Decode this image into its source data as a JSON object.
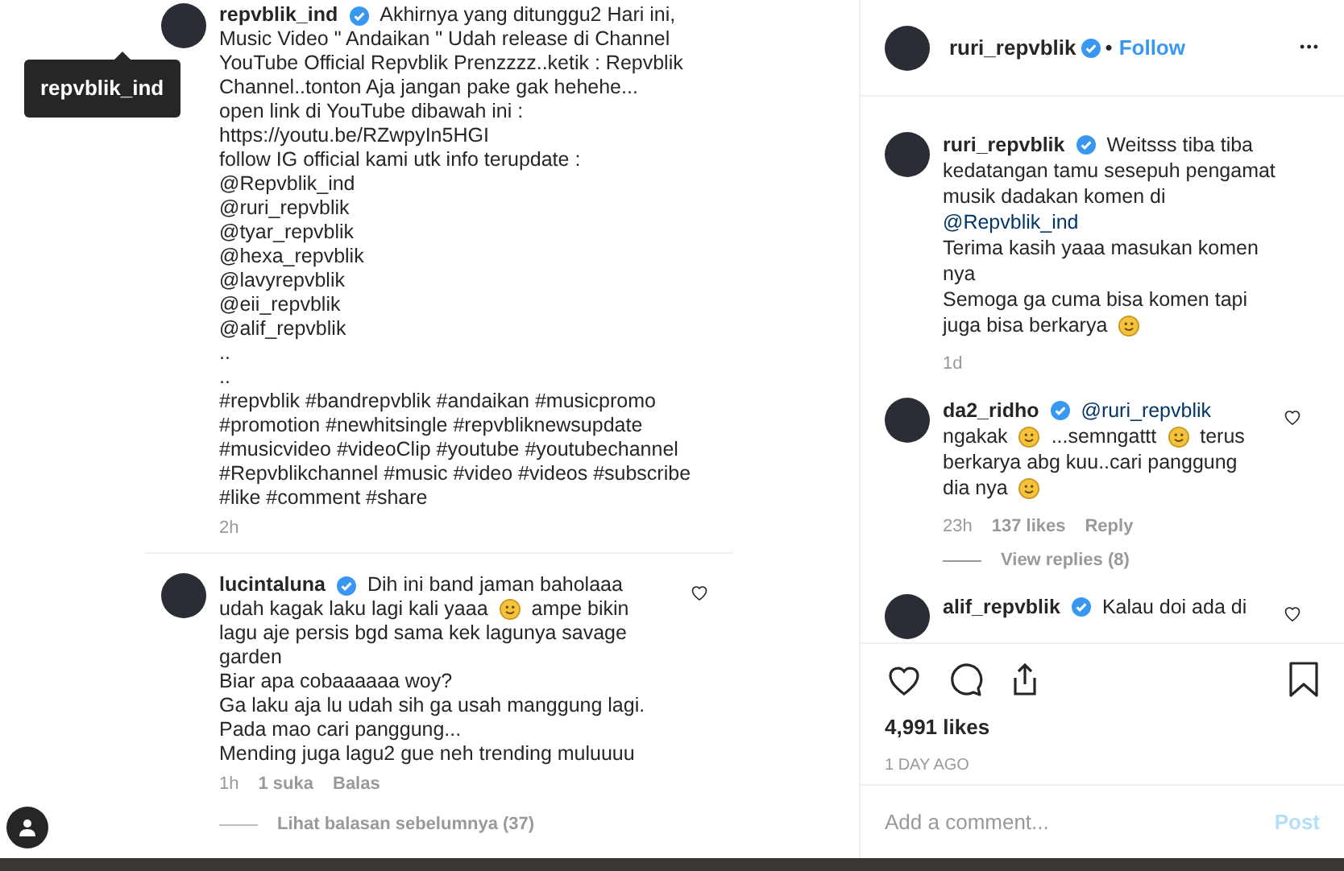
{
  "tooltip": {
    "text": "repvblik_ind"
  },
  "left_comments": [
    {
      "username": "repvblik_ind",
      "verified": true,
      "heart": false,
      "lines": [
        [
          {
            "kind": "text",
            "text": "Akhirnya yang ditunggu2 Hari ini,"
          }
        ],
        [
          {
            "kind": "text",
            "text": "Music Video \" Andaikan \" Udah release di Channel"
          }
        ],
        [
          {
            "kind": "text",
            "text": "YouTube Official Repvblik Prenzzzz..ketik : Repvblik"
          }
        ],
        [
          {
            "kind": "text",
            "text": "Channel..tonton Aja jangan pake gak hehehe..."
          }
        ],
        [
          {
            "kind": "text",
            "text": "open link di YouTube dibawah ini :"
          }
        ],
        [
          {
            "kind": "text",
            "text": "https://youtu.be/RZwpyIn5HGI"
          }
        ],
        [
          {
            "kind": "text",
            "text": "follow IG official kami utk info terupdate :"
          }
        ],
        [
          {
            "kind": "text",
            "text": "@Repvblik_ind"
          }
        ],
        [
          {
            "kind": "text",
            "text": "@ruri_repvblik"
          }
        ],
        [
          {
            "kind": "text",
            "text": "@tyar_repvblik"
          }
        ],
        [
          {
            "kind": "text",
            "text": "@hexa_repvblik"
          }
        ],
        [
          {
            "kind": "text",
            "text": "@lavyrepvblik"
          }
        ],
        [
          {
            "kind": "text",
            "text": "@eii_repvblik"
          }
        ],
        [
          {
            "kind": "text",
            "text": "@alif_repvblik"
          }
        ],
        [
          {
            "kind": "text",
            "text": ".."
          }
        ],
        [
          {
            "kind": "text",
            "text": ".."
          }
        ],
        [
          {
            "kind": "text",
            "text": "#repvblik #bandrepvblik #andaikan #musicpromo"
          }
        ],
        [
          {
            "kind": "text",
            "text": "#promotion #newhitsingle #repvbliknewsupdate"
          }
        ],
        [
          {
            "kind": "text",
            "text": "#musicvideo #videoClip #youtube #youtubechannel"
          }
        ],
        [
          {
            "kind": "text",
            "text": "#Repvblikchannel #music #video #videos #subscribe"
          }
        ],
        [
          {
            "kind": "text",
            "text": "#like #comment #share"
          }
        ]
      ],
      "meta": [
        "2h"
      ]
    },
    {
      "username": "lucintaluna",
      "verified": true,
      "heart": true,
      "lines": [
        [
          {
            "kind": "text",
            "text": "Dih ini band jaman baholaaa"
          }
        ],
        [
          {
            "kind": "text",
            "text": "udah kagak laku lagi kali yaaa"
          },
          {
            "kind": "emoji"
          },
          {
            "kind": "text",
            "text": "ampe bikin"
          }
        ],
        [
          {
            "kind": "text",
            "text": "lagu aje persis bgd sama kek lagunya savage"
          }
        ],
        [
          {
            "kind": "text",
            "text": "garden"
          }
        ],
        [
          {
            "kind": "text",
            "text": "Biar apa cobaaaaaa woy?"
          }
        ],
        [
          {
            "kind": "text",
            "text": "Ga laku aja lu udah sih ga usah manggung lagi."
          }
        ],
        [
          {
            "kind": "text",
            "text": "Pada mao cari panggung..."
          }
        ],
        [
          {
            "kind": "text",
            "text": "Mending juga lagu2 gue neh trending muluuuu"
          }
        ]
      ],
      "meta": [
        "1h",
        "1 suka",
        "Balas"
      ]
    }
  ],
  "left_view_replies": "Lihat balasan sebelumnya (37)",
  "post_header": {
    "username": "ruri_repvblik",
    "verified": true,
    "separator": "•",
    "follow": "Follow",
    "more": "•••"
  },
  "right_comments": [
    {
      "username": "ruri_repvblik",
      "verified": true,
      "heart": false,
      "lines": [
        [
          {
            "kind": "text",
            "text": "Weitsss tiba tiba"
          }
        ],
        [
          {
            "kind": "text",
            "text": "kedatangan tamu sesepuh pengamat"
          }
        ],
        [
          {
            "kind": "text",
            "text": "musik dadakan komen di"
          }
        ],
        [
          {
            "kind": "mention",
            "text": "@Repvblik_ind"
          }
        ],
        [
          {
            "kind": "text",
            "text": "Terima kasih yaaa masukan komen"
          }
        ],
        [
          {
            "kind": "text",
            "text": "nya"
          }
        ],
        [
          {
            "kind": "text",
            "text": "Semoga ga cuma bisa komen tapi"
          }
        ],
        [
          {
            "kind": "text",
            "text": "juga bisa berkarya"
          },
          {
            "kind": "emoji"
          }
        ]
      ],
      "meta": [
        "1d"
      ]
    },
    {
      "username": "da2_ridho",
      "verified": true,
      "heart": true,
      "lines": [
        [
          {
            "kind": "mention",
            "text": "@ruri_repvblik"
          }
        ],
        [
          {
            "kind": "text",
            "text": "ngakak"
          },
          {
            "kind": "emoji"
          },
          {
            "kind": "text",
            "text": "...semngattt"
          },
          {
            "kind": "emoji"
          },
          {
            "kind": "text",
            "text": "terus"
          }
        ],
        [
          {
            "kind": "text",
            "text": "berkarya abg kuu..cari panggung"
          }
        ],
        [
          {
            "kind": "text",
            "text": "dia nya"
          },
          {
            "kind": "emoji"
          }
        ]
      ],
      "meta": [
        "23h",
        "137 likes",
        "Reply"
      ],
      "view_replies": "View replies (8)"
    },
    {
      "username": "alif_repvblik",
      "verified": true,
      "heart": true,
      "lines": [
        [
          {
            "kind": "text",
            "text": "Kalau doi ada di"
          }
        ]
      ]
    }
  ],
  "likes": "4,991 likes",
  "time_ago": "1 DAY AGO",
  "comment_box": {
    "placeholder": "Add a comment...",
    "post": "Post"
  }
}
